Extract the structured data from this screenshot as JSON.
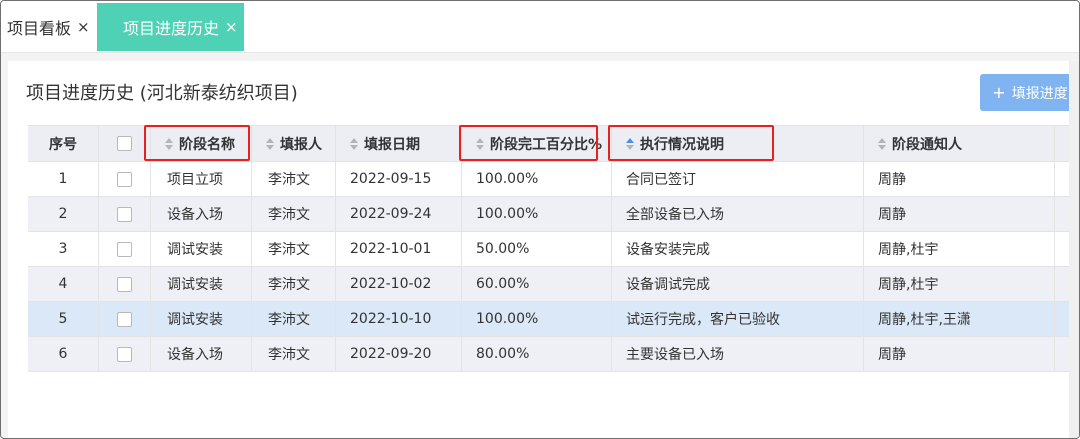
{
  "tabs": [
    {
      "label": "项目看板",
      "close": "×"
    },
    {
      "label": "项目进度历史",
      "close": "×"
    }
  ],
  "page": {
    "title": "项目进度历史 (河北新泰纺织项目)",
    "add_button": {
      "icon": "+",
      "label": "填报进度"
    }
  },
  "table": {
    "headers": {
      "no": "序号",
      "name": "阶段名称",
      "reporter": "填报人",
      "date": "填报日期",
      "percent": "阶段完工百分比%",
      "description": "执行情况说明",
      "notify": "阶段通知人"
    },
    "rows": [
      {
        "no": "1",
        "name": "项目立项",
        "reporter": "李沛文",
        "date": "2022-09-15",
        "percent": "100.00%",
        "description": "合同已签订",
        "notify": "周静"
      },
      {
        "no": "2",
        "name": "设备入场",
        "reporter": "李沛文",
        "date": "2022-09-24",
        "percent": "100.00%",
        "description": "全部设备已入场",
        "notify": "周静"
      },
      {
        "no": "3",
        "name": "调试安装",
        "reporter": "李沛文",
        "date": "2022-10-01",
        "percent": "50.00%",
        "description": "设备安装完成",
        "notify": "周静,杜宇"
      },
      {
        "no": "4",
        "name": "调试安装",
        "reporter": "李沛文",
        "date": "2022-10-02",
        "percent": "60.00%",
        "description": "设备调试完成",
        "notify": "周静,杜宇"
      },
      {
        "no": "5",
        "name": "调试安装",
        "reporter": "李沛文",
        "date": "2022-10-10",
        "percent": "100.00%",
        "description": "试运行完成，客户已验收",
        "notify": "周静,杜宇,王潇"
      },
      {
        "no": "6",
        "name": "设备入场",
        "reporter": "李沛文",
        "date": "2022-09-20",
        "percent": "80.00%",
        "description": "主要设备已入场",
        "notify": "周静"
      }
    ]
  },
  "colors": {
    "active_tab": "#4fd1b6",
    "button": "#7fb4f0",
    "highlight_box": "#e82020",
    "selected_row": "#dbe8f7",
    "sort_active": "#4a90e2"
  }
}
